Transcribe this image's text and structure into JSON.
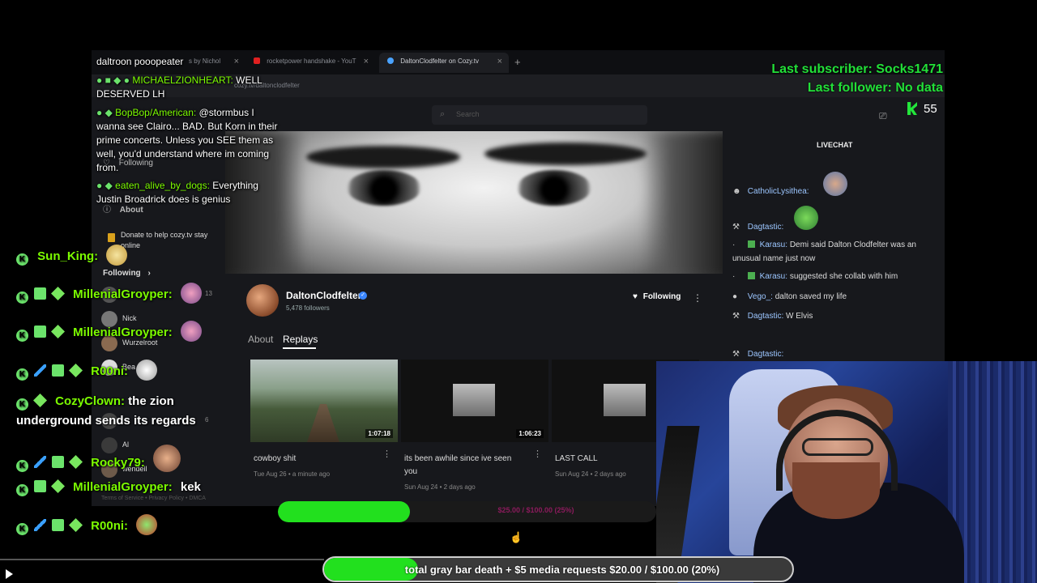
{
  "browser": {
    "tabs": [
      {
        "label": "s by Nichol"
      },
      {
        "label": "rocketpower handshake - YouT"
      },
      {
        "label": "DaltonClodfelter on Cozy.tv"
      }
    ],
    "url": "cozy.tv/daltonclodfelter",
    "search_placeholder": "Search"
  },
  "site_nav": {
    "following_label": "Following",
    "about_label": "About",
    "donate_text": "Donate to help cozy.tv stay online",
    "following_section": "Following",
    "following": [
      {
        "name": "",
        "count": "13"
      },
      {
        "name": "Nick",
        "count": ""
      },
      {
        "name": "Wurzelroot",
        "count": ""
      },
      {
        "name": "Bea",
        "count": ""
      },
      {
        "name": "",
        "count": "6"
      },
      {
        "name": "Al",
        "count": ""
      },
      {
        "name": "wendell",
        "count": ""
      }
    ],
    "footer": "Terms of Service • Privacy Policy • DMCA"
  },
  "channel": {
    "name": "DaltonClodfelter",
    "followers": "5,478 followers",
    "follow_button": "Following",
    "tabs": [
      "About",
      "Replays"
    ],
    "replays": [
      {
        "title": "cowboy shit",
        "date": "Tue Aug 26 • a minute ago",
        "duration": "1:07:18"
      },
      {
        "title": "its been awhile since ive seen you",
        "date": "Sun Aug 24 • 2 days ago",
        "duration": "1:06:23"
      },
      {
        "title": "LAST CALL",
        "date": "Sun Aug 24 • 2 days ago",
        "duration": ""
      }
    ]
  },
  "livechat": {
    "title": "LIVECHAT",
    "messages": [
      {
        "user": "CatholicLysithea:",
        "text": ""
      },
      {
        "user": "Dagtastic:",
        "text": ""
      },
      {
        "user": "Karasu:",
        "text": "Demi said Dalton Clodfelter was an unusual name just now"
      },
      {
        "user": "Karasu:",
        "text": "suggested she collab with him"
      },
      {
        "user": "Vego_:",
        "text": "dalton saved my life"
      },
      {
        "user": "Dagtastic:",
        "text": "W Elvis"
      },
      {
        "user": "Dagtastic:",
        "text": ""
      }
    ]
  },
  "overlay_chat": {
    "first_user": "daltroon pooopeater",
    "messages": [
      {
        "user": "MICHAELZIONHEART:",
        "text": "WELL DESERVED LH"
      },
      {
        "user": "BopBop/American:",
        "text": "@stormbus I wanna see Clairo... BAD. But Korn in their prime concerts. Unless you SEE them as well, you'd understand where im coming from."
      },
      {
        "user": "eaten_alive_by_dogs:",
        "text": "Everything Justin Broadrick does is genius"
      }
    ]
  },
  "stream_info": {
    "last_subscriber": "Last subscriber: Socks1471",
    "last_follower": "Last follower: No data",
    "viewer_count": "55"
  },
  "main_chat": [
    {
      "user": "Sun_King:",
      "text": ""
    },
    {
      "user": "MillenialGroyper:",
      "text": ""
    },
    {
      "user": "MillenialGroyper:",
      "text": ""
    },
    {
      "user": "R00ni:",
      "text": ""
    },
    {
      "user": "CozyClown:",
      "text": "the zion underground sends its regards"
    },
    {
      "user": "Rocky79:",
      "text": ""
    },
    {
      "user": "MillenialGroyper:",
      "text": "kek"
    },
    {
      "user": "R00ni:",
      "text": ""
    }
  ],
  "goal_bars": {
    "inner_text": "$25.00 / $100.00 (25%)",
    "inner_progress": 0.35,
    "main_text": "total gray bar death + $5 media requests $20.00 / $100.00 (20%)",
    "main_progress": 0.2,
    "fill_color": "#22e01e"
  },
  "colors": {
    "username_green": "#7cfc00",
    "subinfo_green": "#22e038",
    "badge_green": "#6be36b"
  }
}
